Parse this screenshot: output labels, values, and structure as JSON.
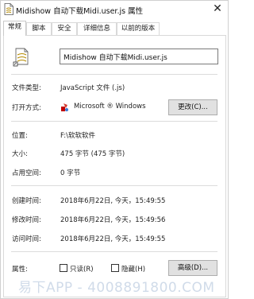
{
  "window": {
    "title": "Midishow 自动下载Midi.user.js 属性",
    "close_glyph": "✕"
  },
  "tabs": [
    {
      "label": "常规",
      "active": true
    },
    {
      "label": "脚本"
    },
    {
      "label": "安全"
    },
    {
      "label": "详细信息"
    },
    {
      "label": "以前的版本"
    }
  ],
  "file": {
    "name": "Midishow 自动下载Midi.user.js",
    "icon": "script-file-icon"
  },
  "properties": {
    "file_type_label": "文件类型:",
    "file_type_value": "JavaScript 文件 (.js)",
    "open_with_label": "打开方式:",
    "open_with_value": "Microsoft ® Windows",
    "open_with_icon": "windows-script-host-icon",
    "change_button": "更改(C)...",
    "location_label": "位置:",
    "location_value": "F:\\软软软件",
    "size_label": "大小:",
    "size_value": "475 字节 (475 字节)",
    "disk_size_label": "占用空间:",
    "disk_size_value": "0 字节",
    "created_label": "创建时间:",
    "created_value": "2018年6月22日, 今天，15:49:55",
    "modified_label": "修改时间:",
    "modified_value": "2018年6月22日, 今天，15:49:56",
    "accessed_label": "访问时间:",
    "accessed_value": "2018年6月22日, 今天，15:49:55",
    "attributes_label": "属性:",
    "readonly_label": "只读(R)",
    "hidden_label": "隐藏(H)",
    "advanced_button": "高级(D)..."
  },
  "watermark": "易下APP - 4008891800.COM"
}
